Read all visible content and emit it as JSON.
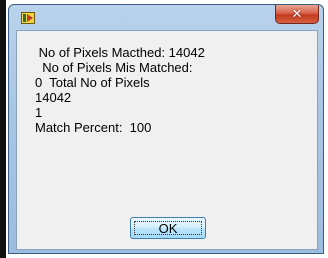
{
  "window": {
    "icon": "labview-vi-icon",
    "close_icon": "close-icon",
    "close_glyph": "✕"
  },
  "message": {
    "lines": [
      " No of Pixels Macthed: 14042",
      "  No of Pixels Mis Matched:",
      "0  Total No of Pixels",
      "14042",
      "1",
      "Match Percent:  100"
    ]
  },
  "dialog": {
    "ok_label": "OK"
  },
  "colors": {
    "titlebar": "#a9c6e4",
    "close_button": "#c23a1f",
    "dialog_background": "#f0f0f0",
    "ok_button_border": "#3c7fb1"
  }
}
